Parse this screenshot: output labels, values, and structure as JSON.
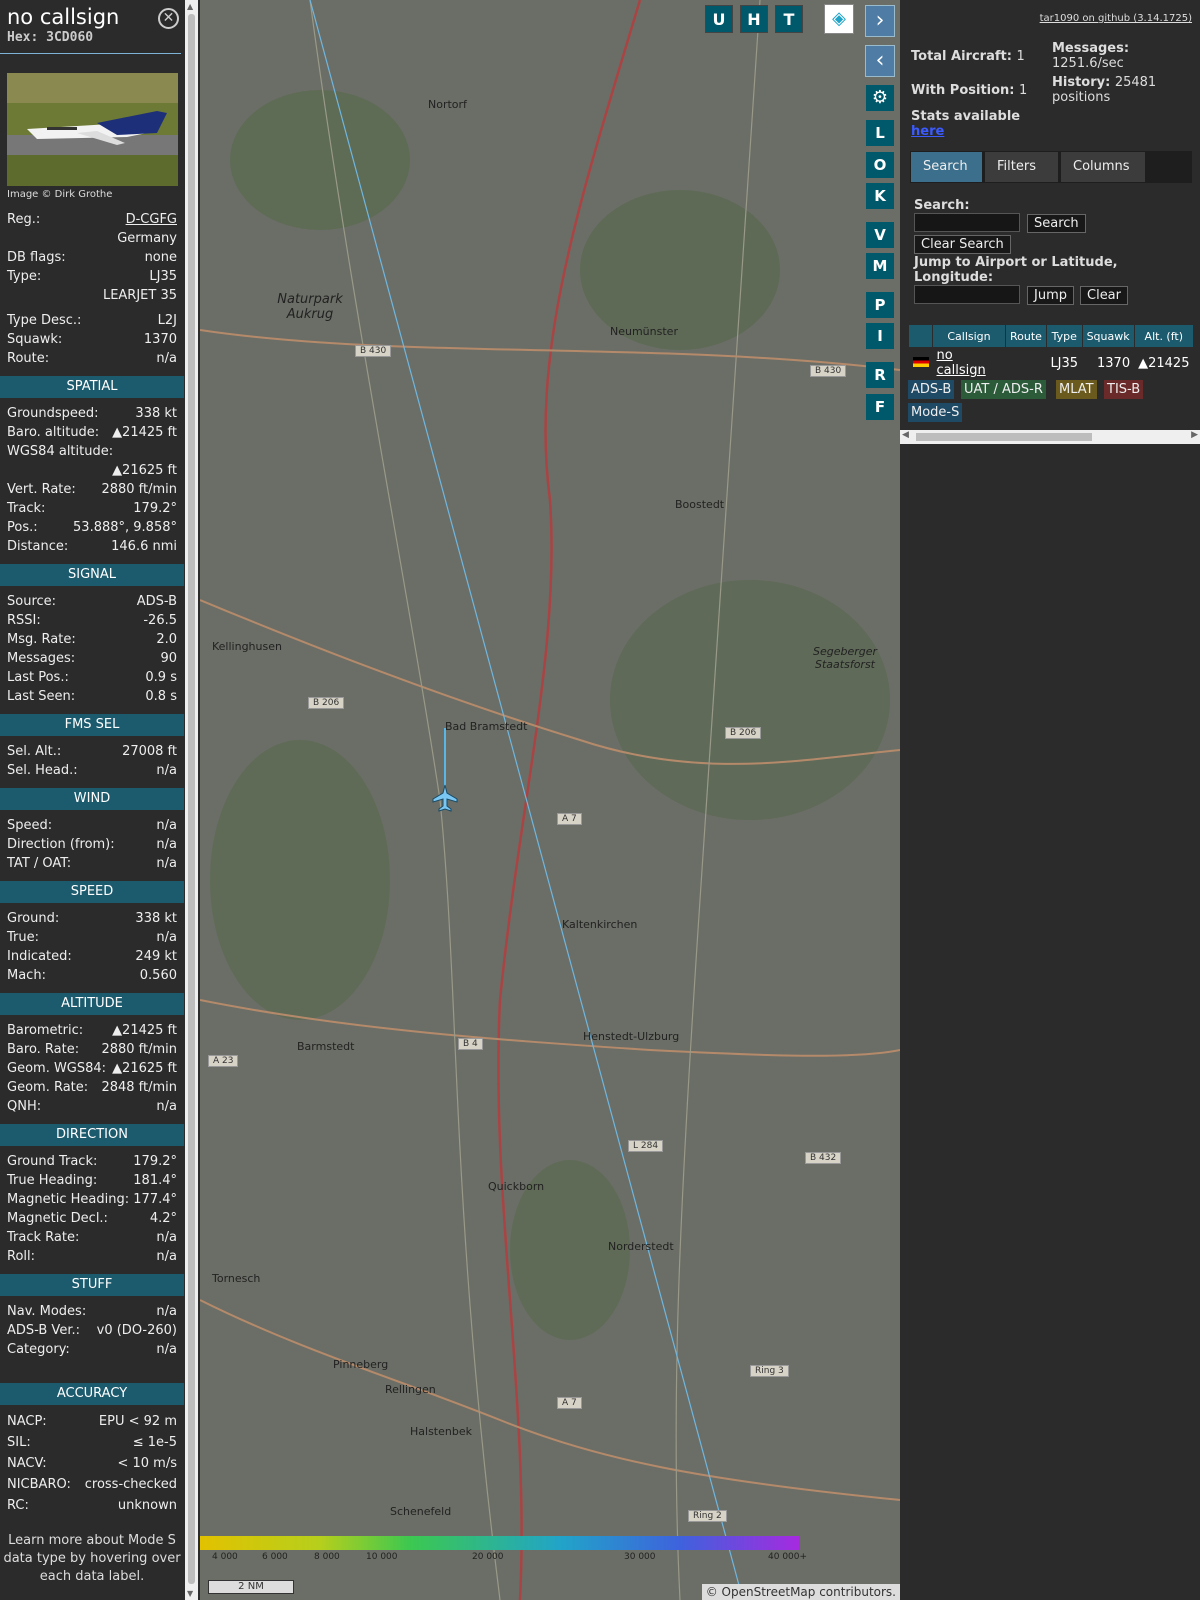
{
  "sidebar": {
    "callsign": "no callsign",
    "hex": "Hex: 3CD060",
    "close": "⊗",
    "photo_credit": "Image © Dirk Grothe",
    "info": [
      {
        "label": "Reg.:",
        "value": "D-CGFG",
        "u": true
      },
      {
        "label": "",
        "value": "Germany"
      },
      {
        "label": "DB flags:",
        "value": "none"
      },
      {
        "label": "Type:",
        "value": "LJ35"
      },
      {
        "label": "",
        "value": "LEARJET 35"
      }
    ],
    "info2": [
      {
        "label": "Type Desc.:",
        "value": "L2J"
      },
      {
        "label": "Squawk:",
        "value": "1370"
      },
      {
        "label": "Route:",
        "value": "n/a"
      }
    ],
    "sections": [
      {
        "title": "SPATIAL",
        "rows": [
          {
            "label": "Groundspeed:",
            "value": "338 kt"
          },
          {
            "label": "Baro. altitude:",
            "value": "▲21425 ft"
          },
          {
            "label": "WGS84 altitude:",
            "value": ""
          },
          {
            "label": "",
            "value": "▲21625 ft"
          },
          {
            "label": "Vert. Rate:",
            "value": "2880 ft/min"
          },
          {
            "label": "Track:",
            "value": "179.2°"
          },
          {
            "label": "Pos.:",
            "value": "53.888°, 9.858°"
          },
          {
            "label": "Distance:",
            "value": "146.6 nmi"
          }
        ]
      },
      {
        "title": "SIGNAL",
        "rows": [
          {
            "label": "Source:",
            "value": "ADS-B"
          },
          {
            "label": "RSSI:",
            "value": "-26.5"
          },
          {
            "label": "Msg. Rate:",
            "value": "2.0"
          },
          {
            "label": "Messages:",
            "value": "90"
          },
          {
            "label": "Last Pos.:",
            "value": "0.9 s"
          },
          {
            "label": "Last Seen:",
            "value": "0.8 s"
          }
        ]
      },
      {
        "title": "FMS SEL",
        "rows": [
          {
            "label": "Sel. Alt.:",
            "value": "27008 ft"
          },
          {
            "label": "Sel. Head.:",
            "value": "n/a"
          }
        ]
      },
      {
        "title": "WIND",
        "rows": [
          {
            "label": "Speed:",
            "value": "n/a"
          },
          {
            "label": "Direction (from):",
            "value": "n/a"
          },
          {
            "label": "TAT / OAT:",
            "value": "n/a"
          }
        ]
      },
      {
        "title": "SPEED",
        "rows": [
          {
            "label": "Ground:",
            "value": "338 kt"
          },
          {
            "label": "True:",
            "value": "n/a"
          },
          {
            "label": "Indicated:",
            "value": "249 kt"
          },
          {
            "label": "Mach:",
            "value": "0.560"
          }
        ]
      },
      {
        "title": "ALTITUDE",
        "rows": [
          {
            "label": "Barometric:",
            "value": "▲21425 ft"
          },
          {
            "label": "Baro. Rate:",
            "value": "2880 ft/min"
          },
          {
            "label": "Geom. WGS84:",
            "value": "▲21625 ft"
          },
          {
            "label": "Geom. Rate:",
            "value": "2848 ft/min"
          },
          {
            "label": "QNH:",
            "value": "n/a"
          }
        ]
      },
      {
        "title": "DIRECTION",
        "rows": [
          {
            "label": "Ground Track:",
            "value": "179.2°"
          },
          {
            "label": "True Heading:",
            "value": "181.4°"
          },
          {
            "label": "Magnetic Heading:",
            "value": "177.4°"
          },
          {
            "label": "Magnetic Decl.:",
            "value": "4.2°"
          },
          {
            "label": "Track Rate:",
            "value": "n/a"
          },
          {
            "label": "Roll:",
            "value": "n/a"
          }
        ]
      },
      {
        "title": "STUFF",
        "rows": [
          {
            "label": "Nav. Modes:",
            "value": "n/a"
          },
          {
            "label": "ADS-B Ver.:",
            "value": "v0 (DO-260)"
          },
          {
            "label": "Category:",
            "value": "n/a"
          }
        ]
      }
    ],
    "accuracy_title": "ACCURACY",
    "accuracy": [
      {
        "label": "NACP:",
        "value": "EPU < 92 m"
      },
      {
        "label": "SIL:",
        "value": "≤ 1e-5"
      },
      {
        "label": "NACV:",
        "value": "< 10 m/s"
      },
      {
        "label": "NICBARO:",
        "value": "cross-checked"
      },
      {
        "label": "RC:",
        "value": "unknown"
      }
    ],
    "footer": "Learn more about Mode S data type by hovering over each data label."
  },
  "map": {
    "top_buttons": [
      "U",
      "H",
      "T"
    ],
    "side_buttons": [
      "L",
      "O",
      "K",
      "V",
      "M",
      "P",
      "I",
      "R",
      "F"
    ],
    "places": [
      "Nortorf",
      "Neumünster",
      "Naturpark Aukrug",
      "Boostedt",
      "Kellinghusen",
      "Bad Bramstedt",
      "Segeberger Staatsforst",
      "Kaltenkirchen",
      "Henstedt-Ulzburg",
      "Barmstedt",
      "Quickborn",
      "Norderstedt",
      "Tornesch",
      "Pinneberg",
      "Rellingen",
      "Halstenbek",
      "Schenefeld"
    ],
    "roads": [
      "B 430",
      "B 430",
      "B 206",
      "B 206",
      "A 7",
      "B 4",
      "A 23",
      "L 284",
      "B 432",
      "A 7",
      "Ring 3",
      "Ring 2"
    ],
    "colorbar_labels": [
      "4 000",
      "6 000",
      "8 000",
      "10 000",
      "20 000",
      "30 000",
      "40 000+"
    ],
    "scale": "2 NM",
    "attribution": "© OpenStreetMap contributors."
  },
  "panel": {
    "github": "tar1090 on github (3.14.1725)",
    "total_label": "Total Aircraft:",
    "total": "1",
    "pos_label": "With Position:",
    "pos": "1",
    "msgs_label": "Messages:",
    "msgs": "1251.6/sec",
    "hist_label": "History:",
    "hist": "25481 positions",
    "stats_label": "Stats available",
    "stats_link": "here",
    "tabs": [
      "Search",
      "Filters",
      "Columns"
    ],
    "search_label": "Search:",
    "search_btn": "Search",
    "clear_search": "Clear Search",
    "jump_label": "Jump to Airport or Latitude, Longitude:",
    "jump_btn": "Jump",
    "clear_btn": "Clear",
    "columns": [
      "Callsign",
      "Route",
      "Type",
      "Squawk",
      "Alt. (ft)"
    ],
    "row": {
      "callsign": "no callsign",
      "route": "",
      "type": "LJ35",
      "squawk": "1370",
      "alt": "▲21425"
    },
    "badges": [
      {
        "label": "ADS-B",
        "color": "#1f4a66"
      },
      {
        "label": "UAT / ADS-R",
        "color": "#2c5b3a"
      },
      {
        "label": "MLAT",
        "color": "#6b5a1e"
      },
      {
        "label": "TIS-B",
        "color": "#6b2a2a"
      },
      {
        "label": "Mode-S",
        "color": "#1f4a66"
      }
    ]
  }
}
